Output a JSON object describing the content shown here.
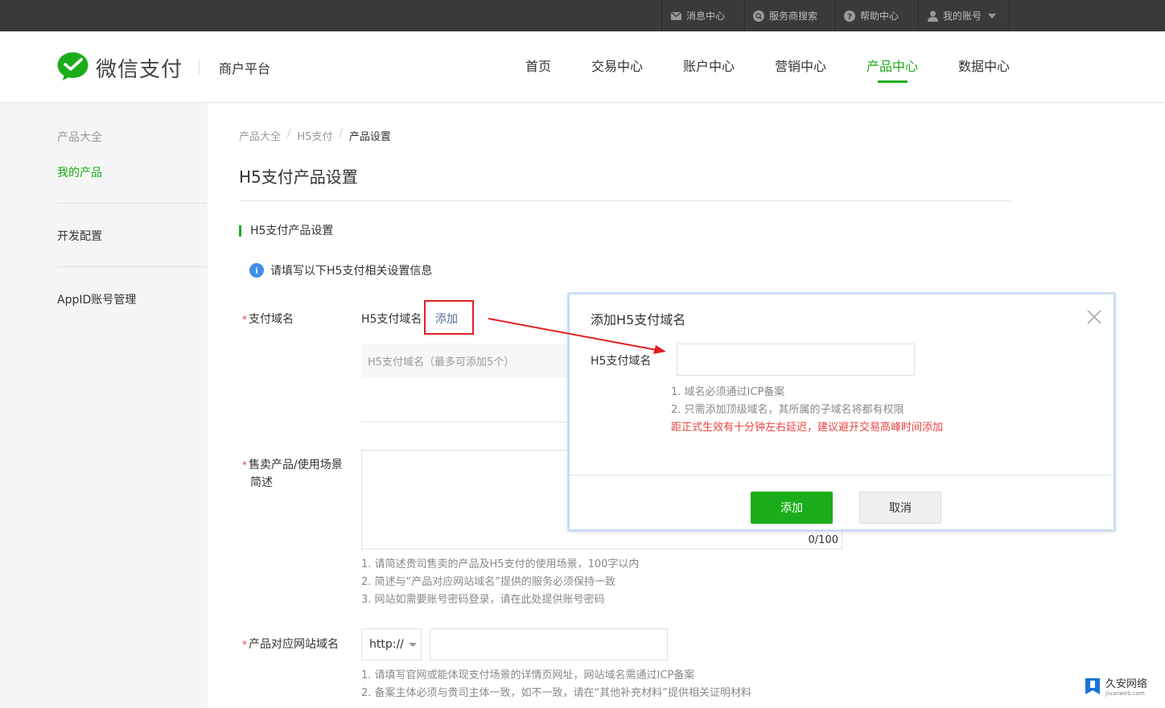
{
  "topbar": {
    "messages": "消息中心",
    "provider_search": "服务商搜索",
    "help": "帮助中心",
    "account": "我的账号"
  },
  "header": {
    "logo": "微信支付",
    "merchant": "商户平台",
    "nav": [
      "首页",
      "交易中心",
      "账户中心",
      "营销中心",
      "产品中心",
      "数据中心"
    ],
    "active_nav": "产品中心"
  },
  "sidebar": {
    "group": "产品大全",
    "my_products": "我的产品",
    "dev_config": "开发配置",
    "appid": "AppID账号管理"
  },
  "main": {
    "breadcrumb": [
      "产品大全",
      "H5支付",
      "产品设置"
    ],
    "title": "H5支付产品设置",
    "section": "H5支付产品设置",
    "info": "请填写以下H5支付相关设置信息",
    "pay_domain": {
      "label": "支付域名",
      "sub_label": "H5支付域名",
      "add": "添加",
      "list_placeholder": "H5支付域名（最多可添加5个）"
    },
    "scenario": {
      "label_line1": "售卖产品/使用场景",
      "label_line2": "简述",
      "counter": "0/100",
      "hints": [
        "1. 请简述贵司售卖的产品及H5支付的使用场景，100字以内",
        "2. 简述与“产品对应网站域名”提供的服务必须保持一致",
        "3. 网站如需要账号密码登录，请在此处提供账号密码"
      ]
    },
    "website": {
      "label": "产品对应网站域名",
      "protocol": "http://",
      "hints": [
        "1. 请填写官网或能体现支付场景的详情页网址，网站域名需通过ICP备案",
        "2. 备案主体必须与贵司主体一致，如不一致，请在“其他补充材料”提供相关证明材料"
      ]
    }
  },
  "dialog": {
    "title": "添加H5支付域名",
    "field_label": "H5支付域名",
    "hints": [
      "1. 域名必须通过ICP备案",
      "2. 只需添加顶级域名，其所属的子域名将都有权限"
    ],
    "warning": "距正式生效有十分钟左右延迟，建议避开交易高峰时间添加",
    "confirm": "添加",
    "cancel": "取消"
  },
  "watermark": {
    "main": "久安网络",
    "sub": "Jiuanweb.com"
  },
  "colors": {
    "brand": "#1aad19",
    "link": "#576b95",
    "warning": "#e64340",
    "annotation": "#e02020"
  }
}
